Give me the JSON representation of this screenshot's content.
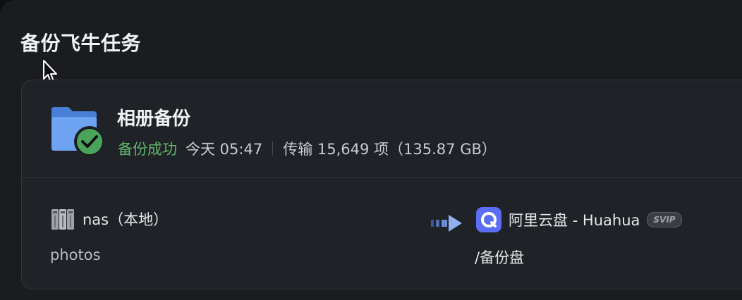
{
  "page": {
    "title": "备份飞牛任务"
  },
  "task": {
    "name": "相册备份",
    "status": "备份成功",
    "time": "今天 05:47",
    "transfer": "传输 15,649 项（135.87 GB）",
    "status_color": "#5fb56a"
  },
  "source": {
    "label": "nas（本地）",
    "path": "photos",
    "icon": "nas-server-icon"
  },
  "destination": {
    "label": "阿里云盘 - Huahua",
    "badge": "SVIP",
    "path": "/备份盘",
    "icon": "aliyun-drive-icon"
  },
  "colors": {
    "accent_blue": "#5b8def",
    "success_green": "#5fb56a"
  }
}
